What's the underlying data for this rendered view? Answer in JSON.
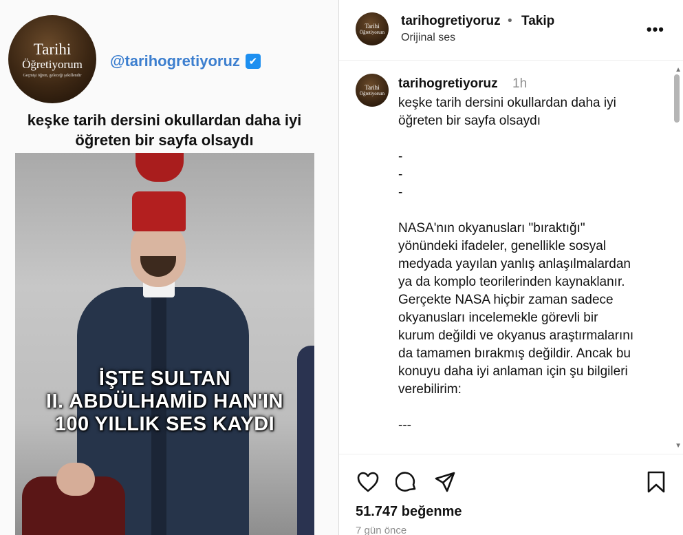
{
  "media": {
    "brand_line1": "Tarihi",
    "brand_line2": "Öğretiyorum",
    "brand_tagline": "Geçmişi öğren, geleceği şekillendir",
    "handle": "@tarihogretiyoruz",
    "verified_mark": "✔",
    "caption": "keşke tarih dersini okullardan daha iyi öğreten bir sayfa olsaydı",
    "overlay_line1": "İŞTE SULTAN",
    "overlay_line2": "II. ABDÜLHAMİD HAN'IN",
    "overlay_line3": "100 YILLIK SES KAYDI"
  },
  "header": {
    "username": "tarihogretiyoruz",
    "separator": "•",
    "follow_label": "Takip",
    "audio_label": "Orijinal ses",
    "more_label": "•••",
    "avatar_line1": "Tarihi",
    "avatar_line2": "Öğretiyorum"
  },
  "post": {
    "username": "tarihogretiyoruz",
    "time": "1h",
    "lines": [
      "keşke tarih dersini okullardan daha iyi",
      "öğreten bir sayfa olsaydı",
      "",
      "-",
      "-",
      "-",
      "",
      "NASA'nın okyanusları \"bıraktığı\"",
      "yönündeki ifadeler, genellikle sosyal",
      "medyada yayılan yanlış anlaşılmalardan",
      "ya da komplo teorilerinden kaynaklanır.",
      "Gerçekte NASA hiçbir zaman sadece",
      "okyanusları incelemekle görevli bir",
      "kurum değildi ve okyanus araştırmalarını",
      "da tamamen bırakmış değildir. Ancak bu",
      "konuyu daha iyi anlaman için şu bilgileri",
      "verebilirim:",
      "",
      "---"
    ]
  },
  "actions": {
    "icons": [
      "heart-icon",
      "comment-icon",
      "share-icon",
      "bookmark-icon"
    ],
    "likes": "51.747 beğenme",
    "ago": "7 gün önce"
  },
  "colors": {
    "handle_blue": "#3d7fcf",
    "verified_blue": "#1d8ff0",
    "fez_red": "#b31f1f",
    "coat_navy": "#26344a",
    "muted_gray": "#8e8e8e"
  }
}
